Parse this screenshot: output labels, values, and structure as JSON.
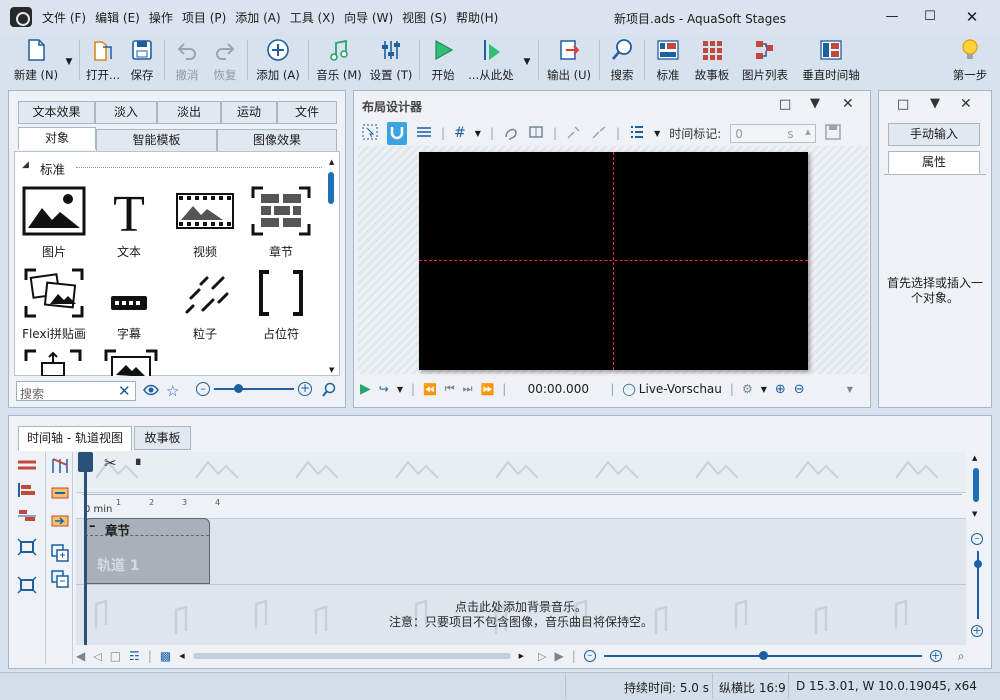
{
  "window": {
    "title": "新项目.ads - AquaSoft Stages"
  },
  "menu": [
    {
      "label": "文件 (F)"
    },
    {
      "label": "编辑 (E)"
    },
    {
      "label": "操作"
    },
    {
      "label": "项目 (P)"
    },
    {
      "label": "添加 (A)"
    },
    {
      "label": "工具 (X)"
    },
    {
      "label": "向导 (W)"
    },
    {
      "label": "视图 (S)"
    },
    {
      "label": "帮助(H)"
    }
  ],
  "toolbar": {
    "new": "新建 (N)",
    "open": "打开...",
    "save": "保存",
    "undo": "撤消",
    "redo": "恢复",
    "add": "添加 (A)",
    "music": "音乐 (M)",
    "settings": "设置 (T)",
    "start": "开始",
    "from_here": "...从此处",
    "output": "输出 (U)",
    "search": "搜索",
    "standard": "标准",
    "storyboard": "故事板",
    "image_list": "图片列表",
    "vertical_timeline": "垂直时间轴",
    "first_step": "第一步"
  },
  "left_panel": {
    "tabs_row1": [
      "文本效果",
      "淡入",
      "淡出",
      "运动",
      "文件"
    ],
    "tabs_row2": [
      "对象",
      "智能模板",
      "图像效果"
    ],
    "section": "标准",
    "items": [
      {
        "label": "图片"
      },
      {
        "label": "文本"
      },
      {
        "label": "视频"
      },
      {
        "label": "章节"
      },
      {
        "label": "Flexi拼贴画"
      },
      {
        "label": "字幕"
      },
      {
        "label": "粒子"
      },
      {
        "label": "占位符"
      }
    ],
    "search_placeholder": "搜索",
    "zoom_fraction": 0.3
  },
  "designer": {
    "title": "布局设计器",
    "time_marker_label": "时间标记:",
    "time_marker_value": "0",
    "time_marker_unit": "s",
    "time": "00:00.000",
    "live_label": "Live-Vorschau"
  },
  "right_panel": {
    "tabs": [
      "手动输入",
      "属性"
    ],
    "message": "首先选择或插入一个对象。"
  },
  "timeline": {
    "tabs": [
      "时间轴 - 轨道视图",
      "故事板"
    ],
    "ruler_start": "0 min",
    "ruler_ticks": [
      "1",
      "2",
      "3",
      "4"
    ],
    "chapter_label": "章节",
    "track_label": "轨道 1",
    "music_hint_1": "点击此处添加背景音乐。",
    "music_hint_2": "注意：只要项目不包含图像，音乐曲目将保持空。",
    "scroll_fraction": 0.5
  },
  "status": {
    "duration": "持续时间: 5.0 s",
    "aspect": "纵横比 16:9",
    "version": "D 15.3.01, W 10.0.19045, x64"
  },
  "colors": {
    "accent": "#1e8fd4",
    "green": "#27a56a",
    "red_guide": "#ff2a2a"
  }
}
